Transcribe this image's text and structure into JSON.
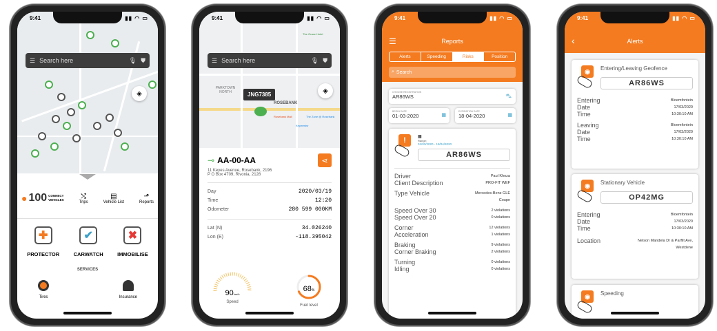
{
  "status_time": "9:41",
  "phone1": {
    "search_placeholder": "Search here",
    "count": "100",
    "count_label_1": "CONNECT",
    "count_label_2": "VEHICLES",
    "nav": [
      {
        "label": "Trips",
        "icon": "trips-icon"
      },
      {
        "label": "Vehicle List",
        "icon": "list-icon"
      },
      {
        "label": "Reports",
        "icon": "reports-icon"
      }
    ],
    "services_big": [
      {
        "label": "PROTECTOR",
        "icon": "protector-icon"
      },
      {
        "label": "CARWATCH",
        "icon": "carwatch-icon"
      },
      {
        "label": "IMMOBILISE",
        "icon": "immobilise-icon"
      }
    ],
    "services_title": "SERVICES",
    "services_small": [
      {
        "label": "Tires",
        "icon": "tire-icon"
      },
      {
        "label": "Insurance",
        "icon": "insurance-icon"
      }
    ]
  },
  "phone2": {
    "search_placeholder": "Search here",
    "map_label": "JNG7385",
    "map_texts": [
      "PARKTOWN NORTH",
      "ROSEBANK",
      "Rosebank Mall",
      "Keywestsr",
      "The Zone @ Rosebank",
      "The Grace Hotel"
    ],
    "plate": "AA-00-AA",
    "address_1": "11 Keyes Avenue, Rosebank, 2196",
    "address_2": "P O Box 4709, Rivonia, 2128",
    "details": [
      {
        "label": "Day",
        "value": "2020/03/19"
      },
      {
        "label": "Time",
        "value": "12:20"
      },
      {
        "label": "Odometer",
        "value": "280 599 000KM"
      }
    ],
    "coords": [
      {
        "label": "Lat (N)",
        "value": "34.026240"
      },
      {
        "label": "Lon (E)",
        "value": "-118.395042"
      }
    ],
    "speed_value": "90",
    "speed_unit": "km/h",
    "speed_label": "Speed",
    "fuel_value": "68",
    "fuel_unit": "%",
    "fuel_label": "Fuel level",
    "fuel_fraction": 0.68
  },
  "phone3": {
    "title": "Reports",
    "tabs": [
      "Alerts",
      "Speeding",
      "Risks",
      "Position"
    ],
    "active_tab": "Risks",
    "search_placeholder": "Search",
    "reg_label": "CHOOSE REGISTRATION",
    "reg_value": "AR86WS",
    "begin_label": "BEGIN DATE",
    "begin_value": "01-03-2020",
    "exp_label": "EXPIRATION DATE",
    "exp_value": "18-04-2020",
    "range_label": "Range:",
    "range_value": "01/03/2020 - 18/04/2020",
    "plate": "AR86WS",
    "rows": [
      {
        "labels": [
          "Driver",
          "Client Description"
        ],
        "values": [
          "Paul Khoza",
          "PRO-FIT WEF"
        ]
      },
      {
        "labels": [
          "Type Vehicle"
        ],
        "values": [
          "Mercedes-Benz GLE Coupe"
        ]
      },
      {
        "labels": [
          "Speed Over 30",
          "Speed Over 20"
        ],
        "values": [
          "2 violations",
          "0 violations"
        ]
      },
      {
        "labels": [
          "Corner",
          "Acceleration"
        ],
        "values": [
          "12 violations",
          "1 violations"
        ]
      },
      {
        "labels": [
          "Braking",
          "Corner Braking"
        ],
        "values": [
          "9 violations",
          "2 violations"
        ]
      },
      {
        "labels": [
          "Turning",
          "Idling"
        ],
        "values": [
          "0 violations",
          "0 violations"
        ]
      }
    ]
  },
  "phone4": {
    "title": "Alerts",
    "cards": [
      {
        "title": "Entering/Leaving Geofence",
        "plate": "AR86WS",
        "rows": [
          {
            "label": "Entering",
            "value": "Bloemfontein"
          },
          {
            "label": "Date",
            "value": "17/03/2020"
          },
          {
            "label": "Time",
            "value": "10:30:10 AM"
          },
          {
            "label": "Leaving",
            "value": "Bloemfontein"
          },
          {
            "label": "Date",
            "value": "17/03/2020"
          },
          {
            "label": "Time",
            "value": "10:30:10 AM"
          }
        ]
      },
      {
        "title": "Stationary Vehicle",
        "plate": "OP42MG",
        "rows": [
          {
            "label": "Entering",
            "value": "Bloemfontein"
          },
          {
            "label": "Date",
            "value": "17/03/2020"
          },
          {
            "label": "Time",
            "value": "10:30:10 AM"
          },
          {
            "label": "Location",
            "value": "Nelson Mandela Dr & Parflit Ave, Westdene"
          }
        ]
      },
      {
        "title": "Speeding",
        "plate": ""
      }
    ]
  },
  "colors": {
    "accent": "#f47b20",
    "map_bg": "#e9ecef",
    "pin_green": "#4caf50"
  }
}
